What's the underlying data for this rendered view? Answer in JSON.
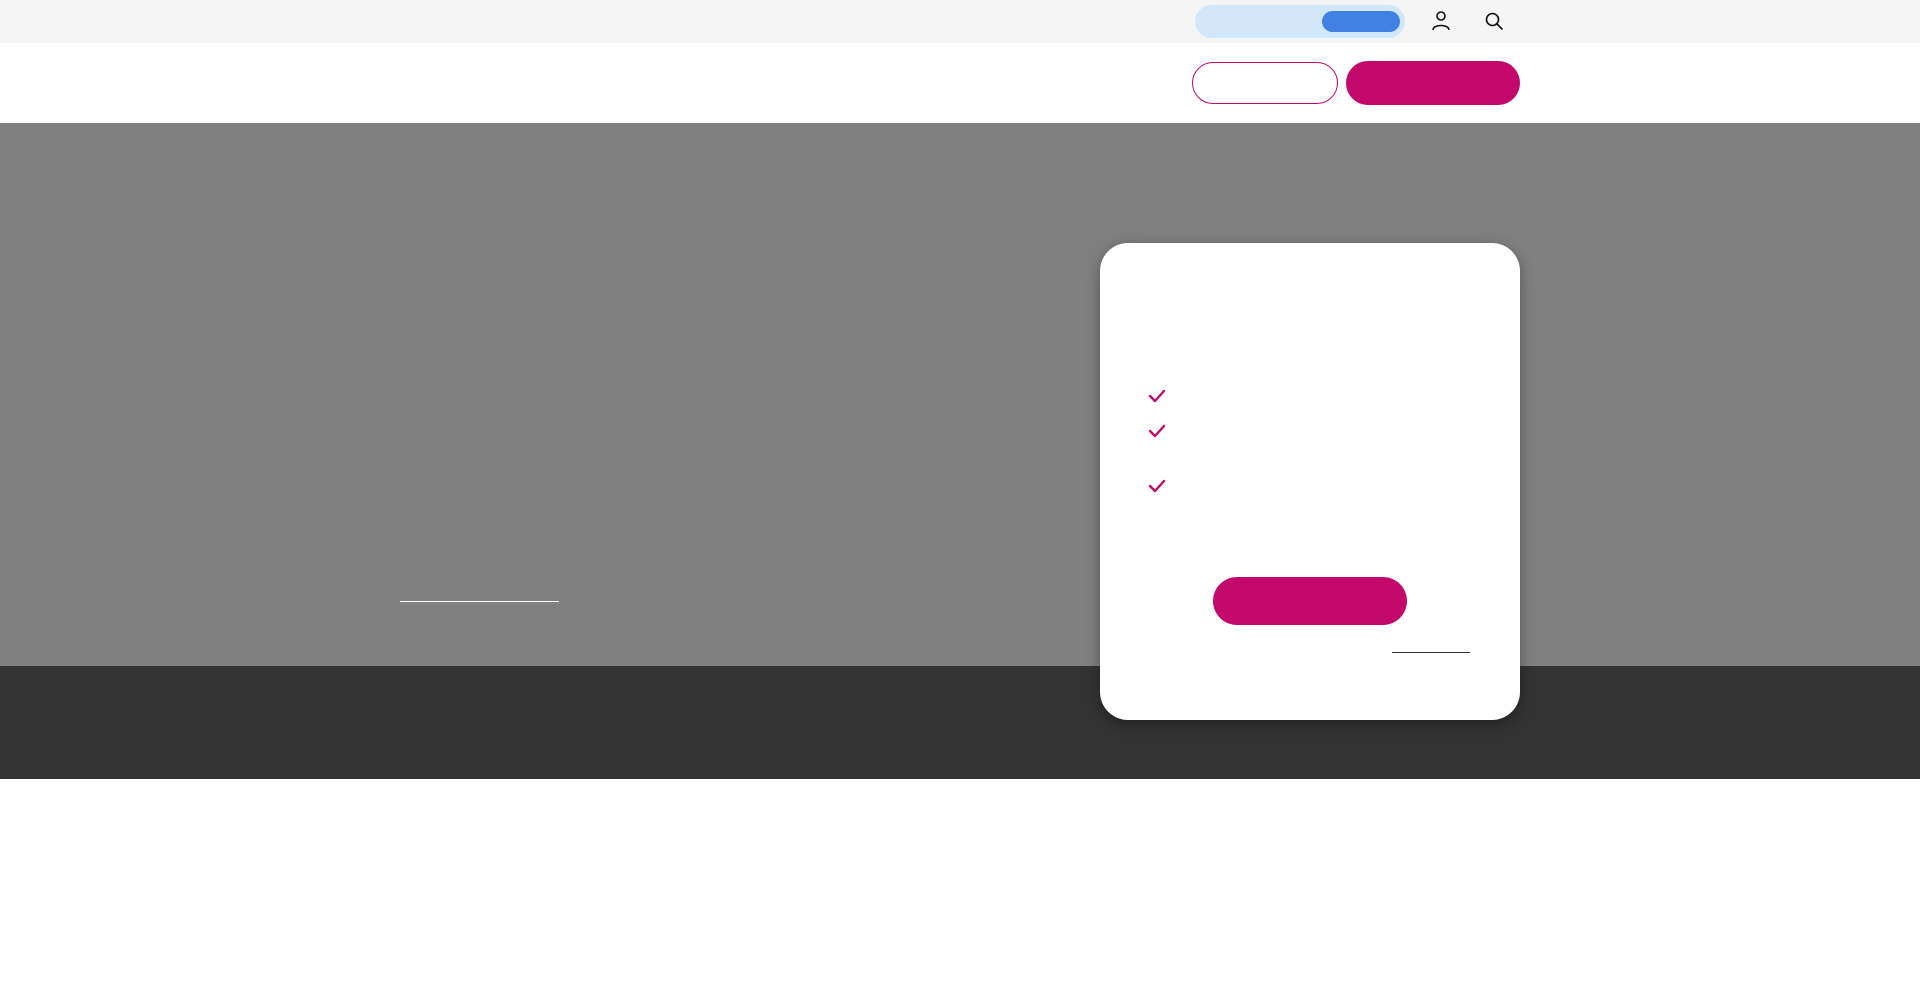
{
  "utility_bar": {
    "toggle_label": "",
    "toggle_knob_label": "",
    "icons": [
      "user-icon",
      "search-icon"
    ]
  },
  "header": {
    "outline_button_label": "",
    "solid_button_label": ""
  },
  "hero": {
    "link_text": ""
  },
  "card": {
    "title": "",
    "subtitle": "",
    "checklist": [
      "",
      "",
      ""
    ],
    "cta_label": "",
    "link_text": ""
  },
  "colors": {
    "brand": "#c2086b",
    "toggle_bg": "#d3e7fb",
    "toggle_knob": "#4181e2",
    "hero_bg": "#808080",
    "band_bg": "#333333",
    "utility_bg": "#f5f5f5"
  }
}
